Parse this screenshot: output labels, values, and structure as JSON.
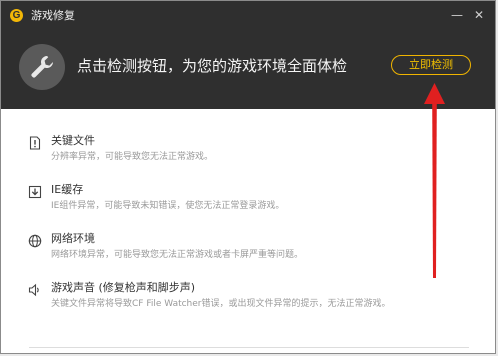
{
  "titlebar": {
    "title": "游戏修复",
    "logo_letter": "G",
    "minimize_glyph": "—",
    "close_glyph": "✕"
  },
  "header": {
    "headline": "点击检测按钮，为您的游戏环境全面体检",
    "detect_button": "立即检测"
  },
  "items": [
    {
      "icon": "warning-file-icon",
      "name": "关键文件",
      "desc": "分辨率异常，可能导致您无法正常游戏。"
    },
    {
      "icon": "download-icon",
      "name": "IE缓存",
      "desc": "IE组件异常，可能导致未知错误，使您无法正常登录游戏。"
    },
    {
      "icon": "globe-icon",
      "name": "网络环境",
      "desc": "网络环境异常，可能导致您无法正常游戏或者卡屏严重等问题。"
    },
    {
      "icon": "speaker-icon",
      "name": "游戏声音 (修复枪声和脚步声)",
      "desc": "关键文件异常将导致CF File Watcher错误，或出现文件异常的提示，无法正常游戏。"
    }
  ],
  "colors": {
    "header_bg": "#2f2f2f",
    "accent": "#f0b400",
    "annotation_arrow": "#e02020"
  }
}
